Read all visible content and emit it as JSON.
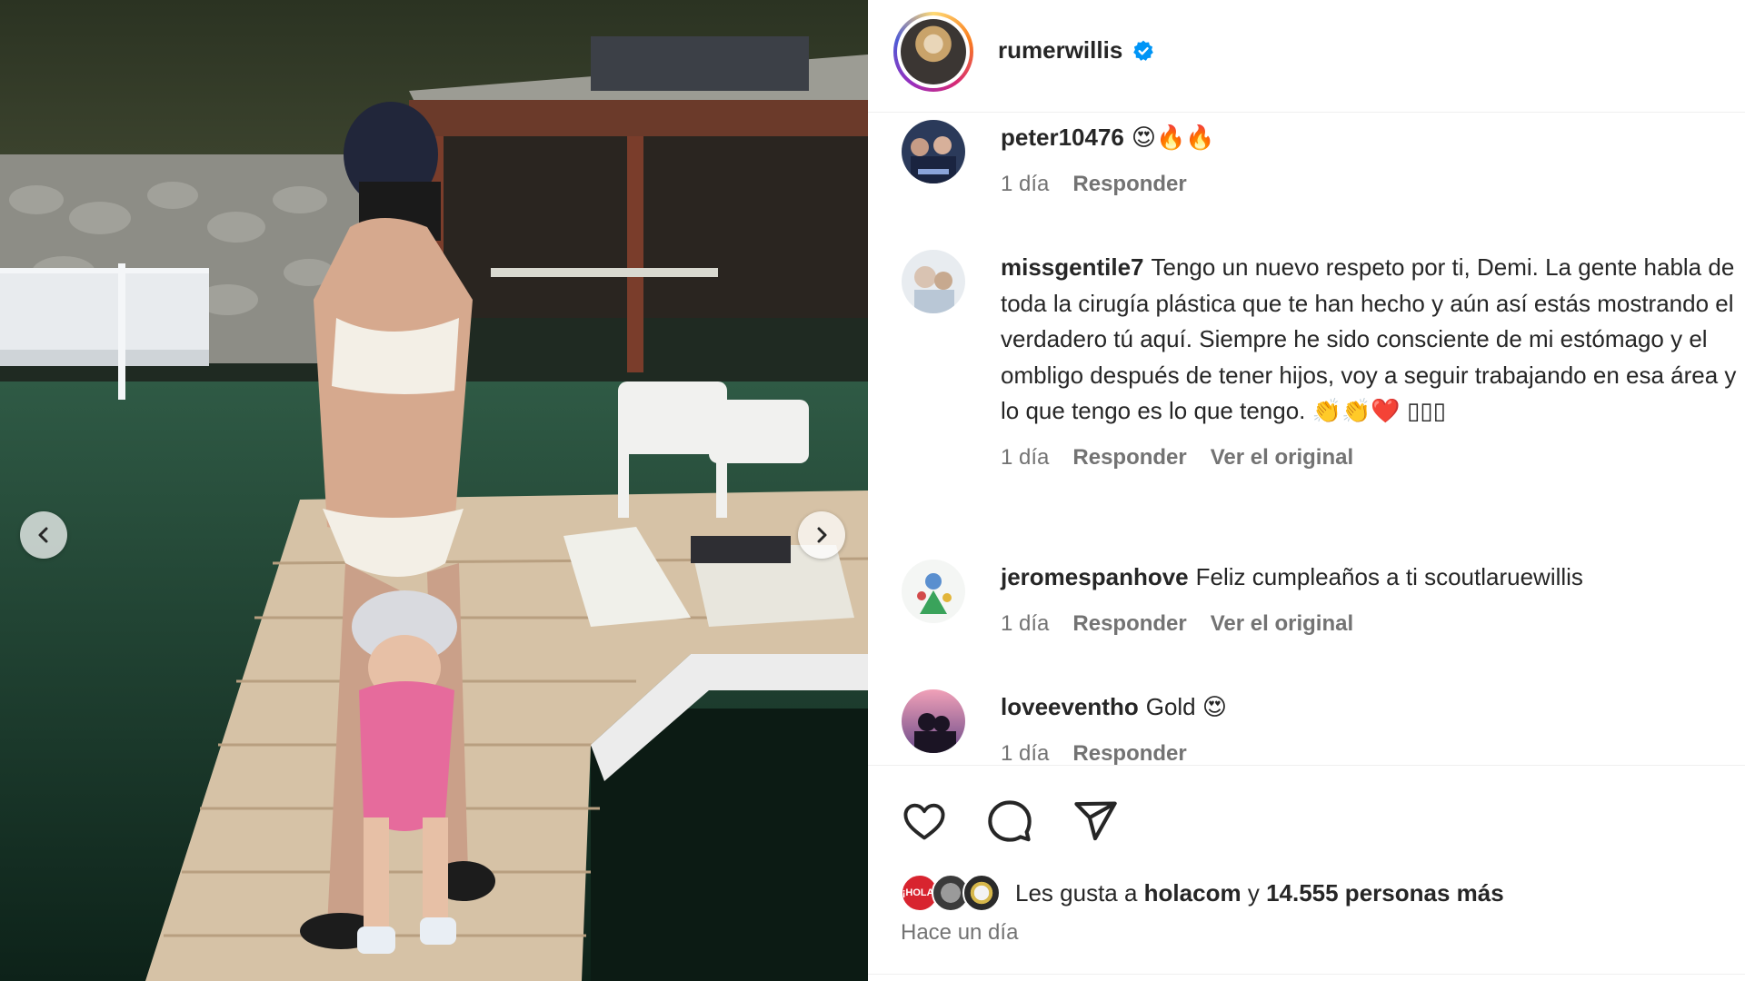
{
  "post": {
    "author": "rumerwillis",
    "verified_icon": "verified-badge-icon",
    "photo_alt": "woman-and-toddler-on-dock-photo"
  },
  "carousel": {
    "prev_icon": "chevron-left-icon",
    "next_icon": "chevron-right-icon"
  },
  "comments": [
    {
      "username": "peter10476",
      "text": "😍🔥🔥",
      "time": "1 día",
      "reply": "Responder",
      "original": ""
    },
    {
      "username": "missgentile7",
      "text": "Tengo un nuevo respeto por ti, Demi. La gente habla de toda la cirugía plástica que te han hecho y aún así estás mostrando el verdadero tú aquí. Siempre he sido consciente de mi estómago y el ombligo después de tener hijos, voy a seguir trabajando en esa área y lo que tengo es lo que tengo. 👏👏❤️ ▯▯▯",
      "time": "1 día",
      "reply": "Responder",
      "original": "Ver el original"
    },
    {
      "username": "jeromespanhove",
      "text": "Feliz cumpleaños a ti scoutlaruewillis",
      "time": "1 día",
      "reply": "Responder",
      "original": "Ver el original"
    },
    {
      "username": "loveeventho",
      "text": "Gold 😍",
      "time": "1 día",
      "reply": "Responder",
      "original": ""
    }
  ],
  "actions": {
    "like_icon": "heart-icon",
    "comment_icon": "comment-bubble-icon",
    "share_icon": "send-icon"
  },
  "likes": {
    "badge_text": "¡HOLA!",
    "prefix": "Les gusta a",
    "account": "holacom",
    "conjunction": "y",
    "count": "14.555 personas más"
  },
  "timestamp": "Hace un día",
  "colors": {
    "text_primary": "#262626",
    "text_secondary": "#737373",
    "verified_blue": "#0095f6",
    "divider": "#efefef"
  }
}
